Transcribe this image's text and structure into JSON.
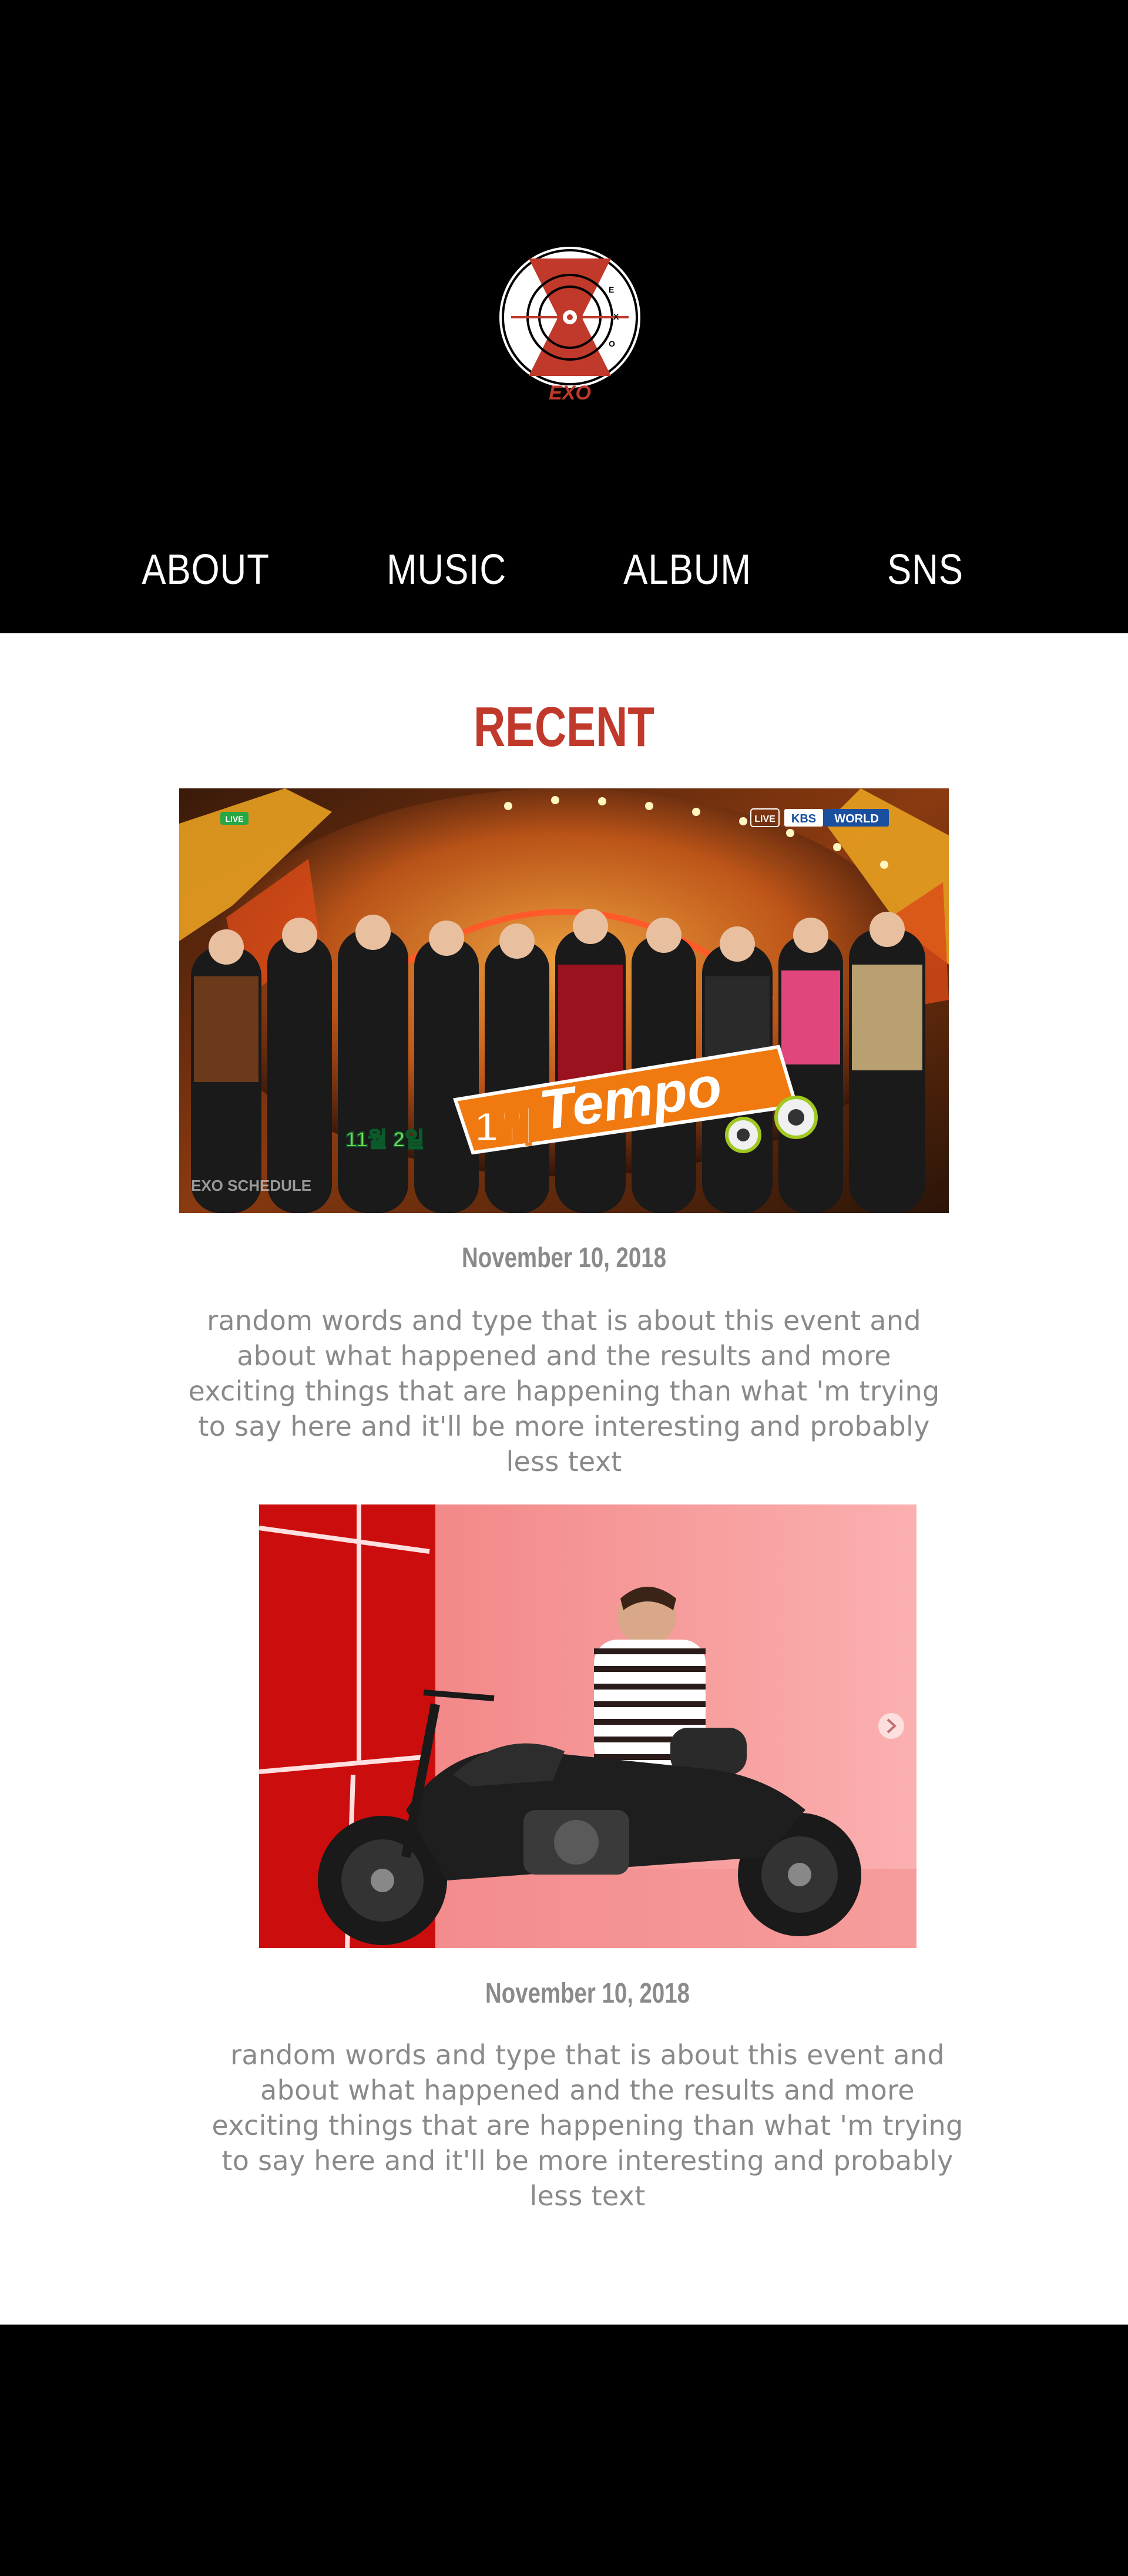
{
  "brand": {
    "logo_text": "EXO",
    "accent_color": "#c0392b"
  },
  "nav": {
    "items": [
      {
        "label": "ABOUT"
      },
      {
        "label": "MUSIC"
      },
      {
        "label": "ALBUM"
      },
      {
        "label": "SNS"
      }
    ]
  },
  "recent": {
    "title": "RECENT",
    "title_color": "#c0392b",
    "posts": [
      {
        "image_icon": "stage-award-photo",
        "overlay": {
          "live_badge": "LIVE",
          "network": "KBS",
          "network_suffix": "WORLD",
          "rank": "1위",
          "song": "Tempo",
          "date_badge": "11월 2일",
          "watermark": "EXO SCHEDULE"
        },
        "date": "November 10, 2018",
        "body": "random words and type that is about this event and about what happened and the results and more exciting things that are happening than what 'm trying to say here and it'll be more interesting and probably less text"
      },
      {
        "image_icon": "motorcycle-photo",
        "carousel_icon": "chevron-right-icon",
        "date": "November 10, 2018",
        "body": "random words and type that is about this event and about what happened and the results and more exciting things that are happening than what 'm trying to say here and it'll be more interesting and probably less text"
      }
    ]
  }
}
